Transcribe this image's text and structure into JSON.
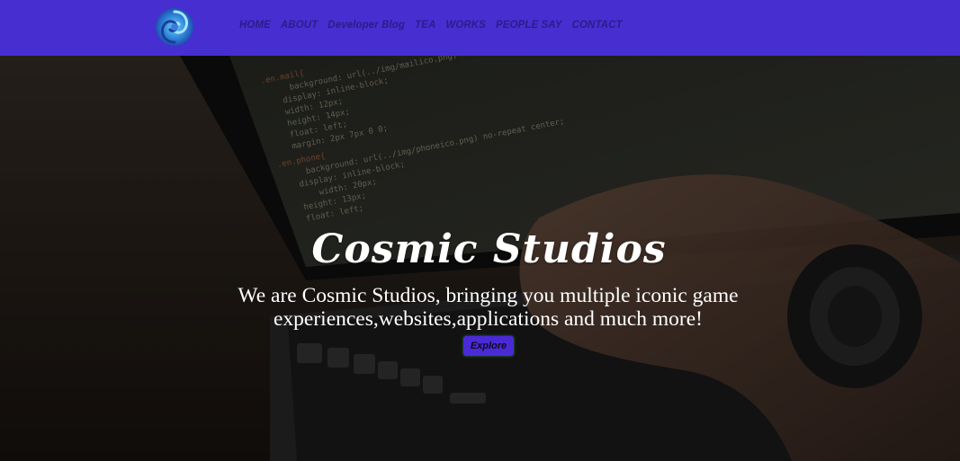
{
  "nav": {
    "logo_icon": "swirl-logo-icon",
    "links": [
      "HOME",
      "ABOUT",
      "Developer Blog",
      "TEA",
      "WORKS",
      "PEOPLE SAY",
      "CONTACT"
    ]
  },
  "hero": {
    "title": "Cosmic Studios",
    "subtitle": "We are Cosmic Studios, bringing you multiple iconic game experiences,websites,applications and much more!",
    "button_label": "Explore",
    "background_image": "laptop-code-photo"
  },
  "colors": {
    "navbar": "#472ed1",
    "nav_text": "#2a1d86",
    "button": "#4a2ad6",
    "text": "#ffffff"
  }
}
